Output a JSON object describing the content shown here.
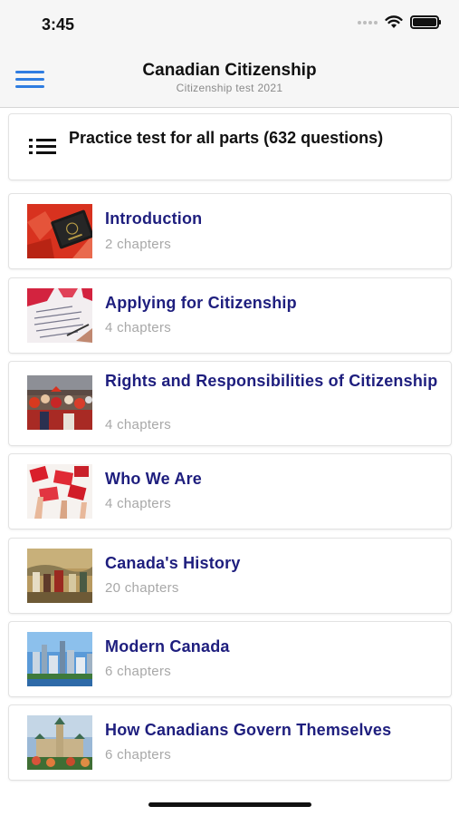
{
  "status_bar": {
    "time": "3:45"
  },
  "header": {
    "title": "Canadian Citizenship",
    "subtitle": "Citizenship test 2021",
    "menu_icon": "hamburger-menu-icon"
  },
  "practice": {
    "label": "Practice test for all parts (632 questions)",
    "icon": "list-icon"
  },
  "chapters": [
    {
      "title": "Introduction",
      "subtitle": "2 chapters",
      "image": "passport-on-maple-leaf"
    },
    {
      "title": "Applying for Citizenship",
      "subtitle": "4 chapters",
      "image": "application-form-with-flag"
    },
    {
      "title": "Rights and Responsibilities of Citizenship",
      "subtitle": "4 chapters",
      "image": "crowd-celebration"
    },
    {
      "title": "Who We Are",
      "subtitle": "4 chapters",
      "image": "hands-waving-flags"
    },
    {
      "title": "Canada's History",
      "subtitle": "20 chapters",
      "image": "historical-painting"
    },
    {
      "title": "Modern Canada",
      "subtitle": "6 chapters",
      "image": "city-skyline"
    },
    {
      "title": "How Canadians Govern Themselves",
      "subtitle": "6 chapters",
      "image": "parliament-building"
    }
  ],
  "colors": {
    "accent": "#2f7de1",
    "chapter_title": "#1e1e7e",
    "subtitle_gray": "#a8a8a8",
    "bar_bg": "#f6f6f6"
  }
}
